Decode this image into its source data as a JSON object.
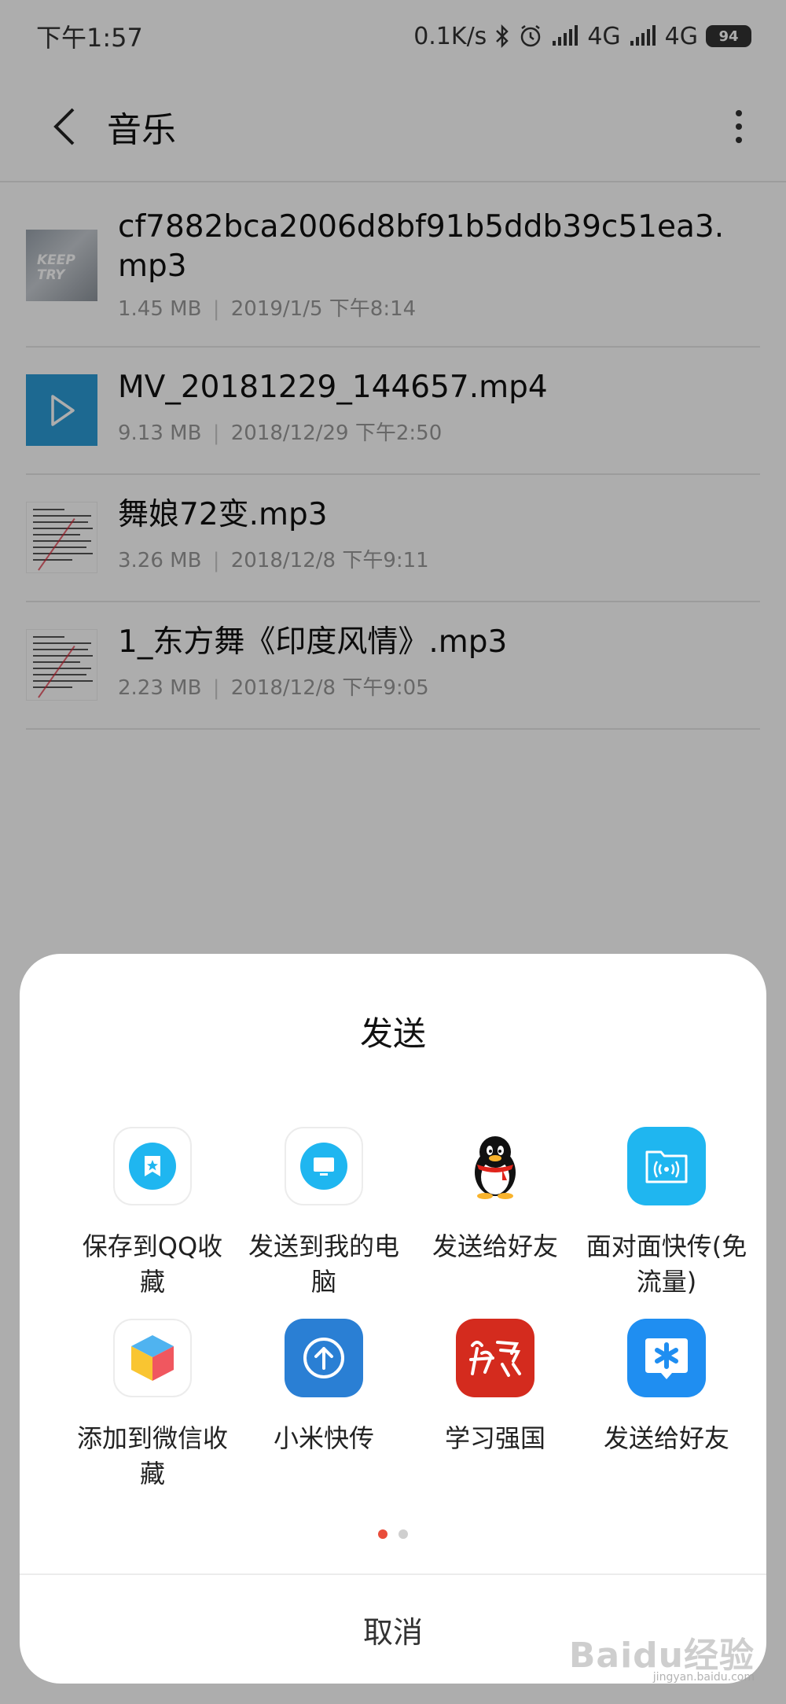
{
  "status_bar": {
    "time": "下午1:57",
    "net_speed": "0.1K/s",
    "signal1": "4G",
    "signal2": "4G",
    "battery": "94"
  },
  "app_bar": {
    "title": "音乐"
  },
  "files": [
    {
      "name": "cf7882bca2006d8bf91b5ddb39c51ea3.mp3",
      "size": "1.45 MB",
      "date": "2019/1/5 下午8:14",
      "thumb": "keep-cover",
      "thumb_text": "KEEP TRY"
    },
    {
      "name": "MV_20181229_144657.mp4",
      "size": "9.13 MB",
      "date": "2018/12/29 下午2:50",
      "thumb": "video-play-icon"
    },
    {
      "name": "舞娘72变.mp3",
      "size": "3.26 MB",
      "date": "2018/12/8 下午9:11",
      "thumb": "document-thumbnail"
    },
    {
      "name": "1_东方舞《印度风情》.mp3",
      "size": "2.23 MB",
      "date": "2018/12/8 下午9:05",
      "thumb": "document-thumbnail"
    }
  ],
  "share_sheet": {
    "title": "发送",
    "items": [
      {
        "label": "保存到QQ收藏",
        "icon": "qq-favorites-icon"
      },
      {
        "label": "发送到我的电脑",
        "icon": "my-computer-icon"
      },
      {
        "label": "发送给好友",
        "icon": "qq-penguin-icon"
      },
      {
        "label": "面对面快传(免流量)",
        "icon": "face-to-face-transfer-icon"
      },
      {
        "label": "添加到微信收藏",
        "icon": "wechat-favorites-cube-icon"
      },
      {
        "label": "小米快传",
        "icon": "mi-drop-icon"
      },
      {
        "label": "学习强国",
        "icon": "xuexi-qiangguo-icon"
      },
      {
        "label": "发送给好友",
        "icon": "tim-icon"
      }
    ],
    "page_count": 2,
    "current_page": 1,
    "cancel_label": "取消"
  },
  "watermark": {
    "text": "Baidu经验",
    "sub": "jingyan.baidu.com"
  },
  "colors": {
    "overlay": "rgba(0,0,0,0.32)",
    "active_dot": "#e94d3b",
    "qq_blue": "#1fb6f0",
    "mi_drop_blue": "#2a7fd4",
    "xuexi_red": "#d42b1e",
    "tim_blue": "#1f8ef1"
  }
}
